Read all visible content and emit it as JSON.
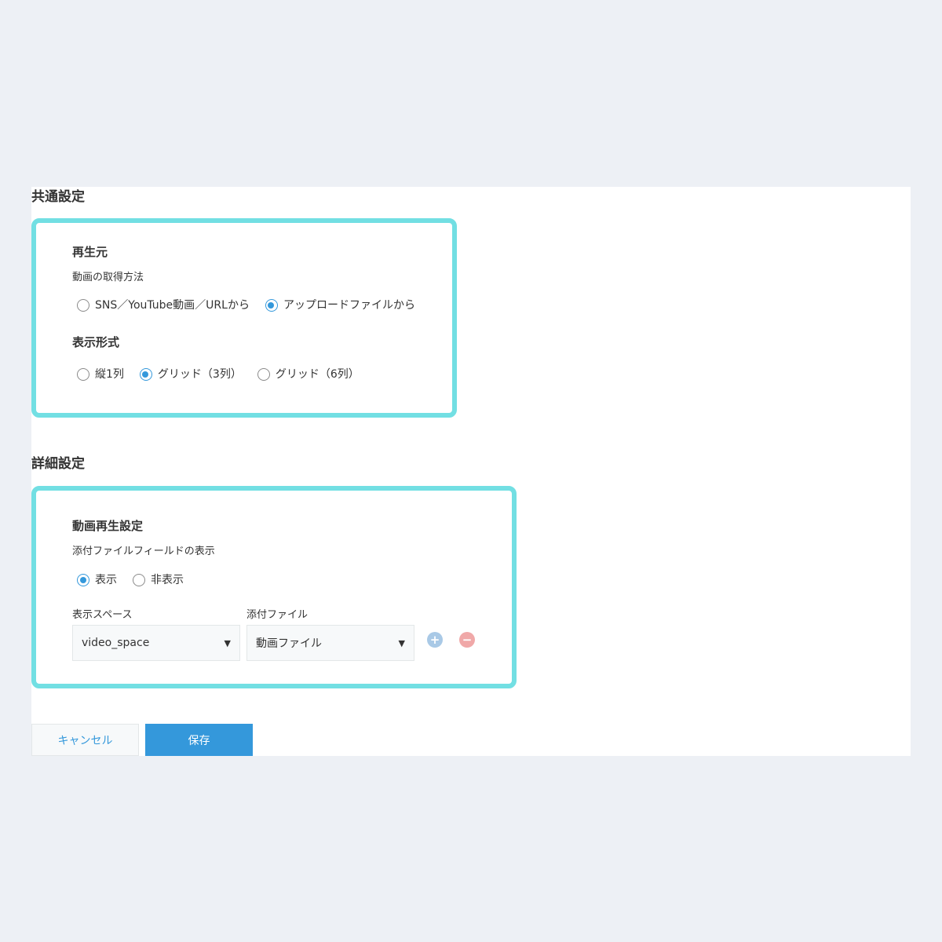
{
  "common": {
    "title": "共通設定",
    "source": {
      "title": "再生元",
      "method_label": "動画の取得方法",
      "options": [
        "SNS／YouTube動画／URLから",
        "アップロードファイルから"
      ]
    },
    "display": {
      "title": "表示形式",
      "options": [
        "縦1列",
        "グリッド（3列）",
        "グリッド（6列）"
      ]
    }
  },
  "detail": {
    "title": "詳細設定",
    "video": {
      "title": "動画再生設定",
      "field_label": "添付ファイルフィールドの表示",
      "options": [
        "表示",
        "非表示"
      ],
      "space_label": "表示スペース",
      "space_value": "video_space",
      "file_label": "添付ファイル",
      "file_value": "動画ファイル",
      "add_symbol": "+",
      "remove_symbol": "−"
    }
  },
  "buttons": {
    "cancel": "キャンセル",
    "save": "保存"
  },
  "colors": {
    "accent": "#3498db",
    "highlight_border": "#72dfe3",
    "add_button": "#a9c9e6",
    "remove_button": "#f0a8a8"
  }
}
